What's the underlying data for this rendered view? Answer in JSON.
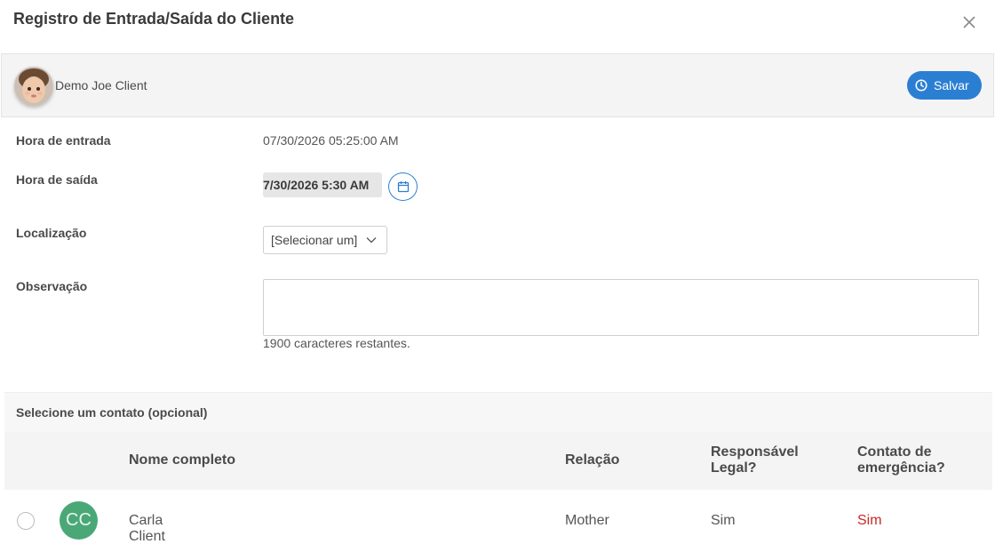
{
  "modal": {
    "title": "Registro de Entrada/Saída do Cliente"
  },
  "client": {
    "name": "Demo Joe Client",
    "save_label": "Salvar"
  },
  "form": {
    "checkin_label": "Hora de entrada",
    "checkin_value": "07/30/2026 05:25:00 AM",
    "checkout_label": "Hora de saída",
    "checkout_value": "7/30/2026 5:30 AM",
    "location_label": "Localização",
    "location_selected": "[Selecionar um]",
    "notes_label": "Observação",
    "notes_value": "",
    "chars_remaining": "1900 caracteres restantes."
  },
  "contacts": {
    "section_title": "Selecione um contato (opcional)",
    "columns": {
      "full_name": "Nome completo",
      "relation": "Relação",
      "legal_guardian_line1": "Responsável",
      "legal_guardian_line2": "Legal?",
      "emergency_line1": "Contato de",
      "emergency_line2": "emergência?"
    },
    "rows": [
      {
        "initials": "CC",
        "full_name": "Carla Client",
        "relation": "Mother",
        "legal_guardian": "Sim",
        "emergency": "Sim"
      }
    ]
  },
  "colors": {
    "accent": "#2b7fd2",
    "avatar_green": "#4aa876",
    "emergency_red": "#c62828"
  },
  "icons": {
    "close": "close-icon",
    "save": "clock-icon",
    "calendar": "calendar-icon",
    "dropdown": "chevron-down-icon"
  }
}
